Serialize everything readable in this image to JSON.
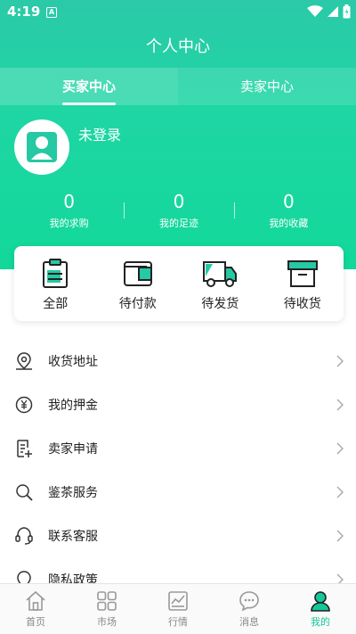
{
  "status_bar": {
    "time": "4:19",
    "notif_letter": "A"
  },
  "header": {
    "title": "个人中心"
  },
  "tabs": [
    {
      "label": "买家中心",
      "active": true
    },
    {
      "label": "卖家中心",
      "active": false
    }
  ],
  "user": {
    "login_text": "未登录"
  },
  "stats": [
    {
      "value": "0",
      "label": "我的求购"
    },
    {
      "value": "0",
      "label": "我的足迹"
    },
    {
      "value": "0",
      "label": "我的收藏"
    }
  ],
  "orders": [
    {
      "label": "全部",
      "icon": "clipboard-icon"
    },
    {
      "label": "待付款",
      "icon": "wallet-icon"
    },
    {
      "label": "待发货",
      "icon": "truck-icon"
    },
    {
      "label": "待收货",
      "icon": "box-icon"
    }
  ],
  "menu": [
    {
      "label": "收货地址",
      "icon": "location-pin-icon"
    },
    {
      "label": "我的押金",
      "icon": "yuan-coin-icon"
    },
    {
      "label": "卖家申请",
      "icon": "document-add-icon"
    },
    {
      "label": "鉴茶服务",
      "icon": "search-icon"
    },
    {
      "label": "联系客服",
      "icon": "headset-icon"
    },
    {
      "label": "隐私政策",
      "icon": "shield-icon"
    }
  ],
  "bottom_nav": [
    {
      "label": "首页",
      "icon": "home-icon",
      "active": false
    },
    {
      "label": "市场",
      "icon": "grid-icon",
      "active": false
    },
    {
      "label": "行情",
      "icon": "chart-icon",
      "active": false
    },
    {
      "label": "消息",
      "icon": "chat-icon",
      "active": false
    },
    {
      "label": "我的",
      "icon": "user-icon",
      "active": true
    }
  ],
  "colors": {
    "accent": "#16c79a",
    "header_top": "#2bc9a8",
    "header_bottom": "#12d89a"
  }
}
